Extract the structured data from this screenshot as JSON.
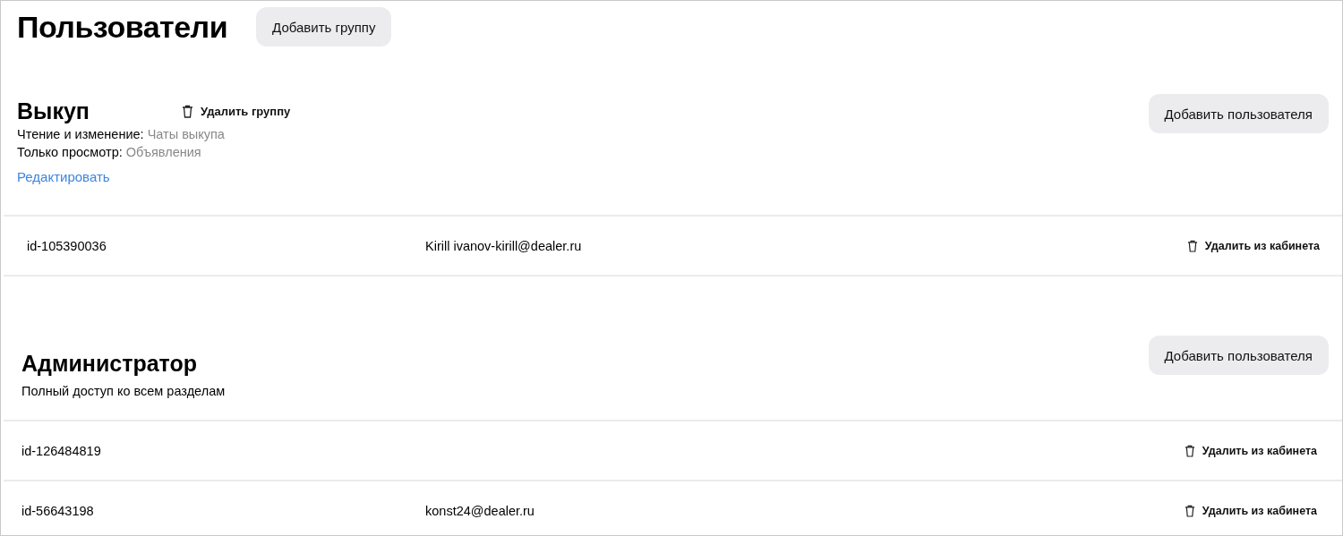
{
  "page_title": "Пользователи",
  "add_group_button": "Добавить группу",
  "groups": [
    {
      "name": "Выкуп",
      "delete_group": "Удалить группу",
      "permissions": [
        {
          "label": "Чтение и изменение:",
          "value": "Чаты выкупа"
        },
        {
          "label": "Только просмотр:",
          "value": "Объявления"
        }
      ],
      "edit_link": "Редактировать",
      "add_user_button": "Добавить пользователя",
      "users": [
        {
          "id": "id-105390036",
          "email": "Kirill ivanov-kirill@dealer.ru",
          "remove": "Удалить из кабинета"
        }
      ]
    },
    {
      "name": "Администратор",
      "description": "Полный доступ ко всем разделам",
      "add_user_button": "Добавить пользователя",
      "users": [
        {
          "id": "id-126484819",
          "remove": "Удалить из кабинета"
        },
        {
          "id": "id-56643198",
          "email": "konst24@dealer.ru",
          "remove": "Удалить из кабинета"
        }
      ]
    }
  ]
}
